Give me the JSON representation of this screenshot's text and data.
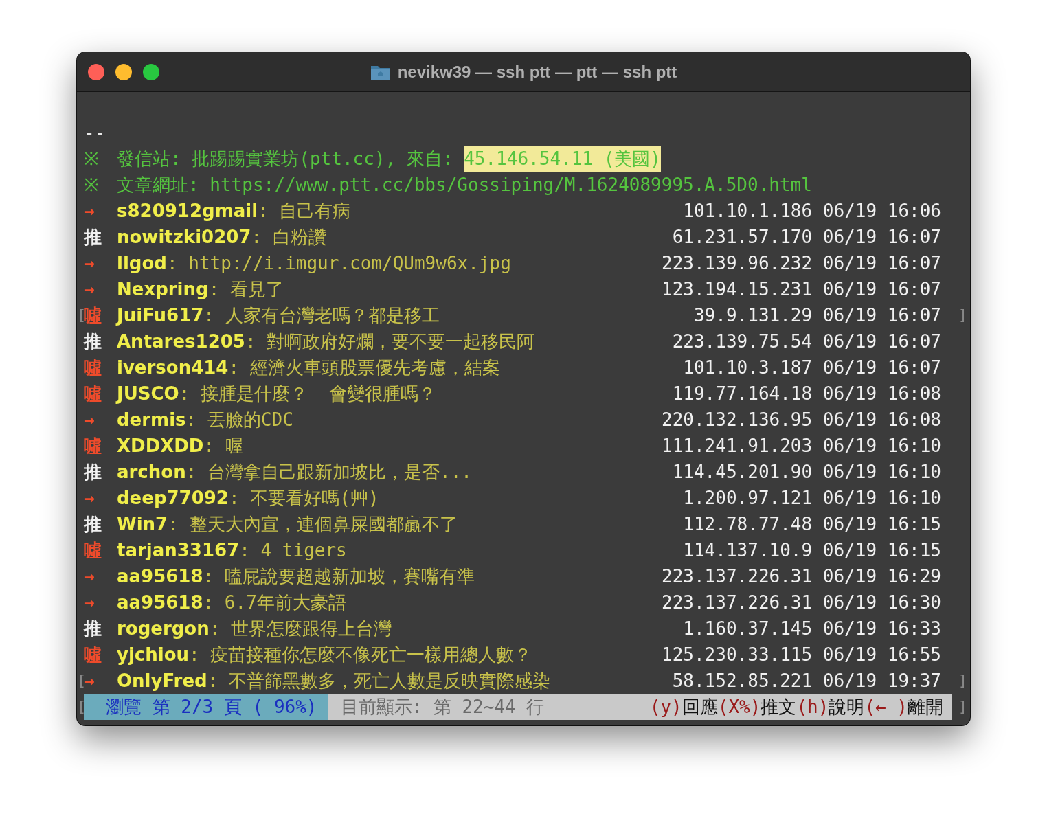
{
  "window": {
    "title": "nevikw39 — ssh ptt — ptt — ssh ptt"
  },
  "terminal": {
    "separator": "--",
    "signature": [
      {
        "mark": "※",
        "label": "發信站: 批踢踢實業坊(ptt.cc), 來自: ",
        "highlight": "45.146.54.11 (美國)"
      },
      {
        "mark": "※",
        "label": "文章網址: https://www.ptt.cc/bbs/Gossiping/M.1624089995.A.5D0.html"
      }
    ],
    "comments": [
      {
        "kind": "arrow",
        "tag": "→",
        "user": "s820912gmail",
        "text": ": 自己有病",
        "ip": "101.10.1.186",
        "datetime": "06/19 16:06"
      },
      {
        "kind": "push",
        "tag": "推",
        "user": "nowitzki0207",
        "text": ": 白粉讚",
        "ip": "61.231.57.170",
        "datetime": "06/19 16:07"
      },
      {
        "kind": "arrow",
        "tag": "→",
        "user": "llgod",
        "text": ": http://i.imgur.com/QUm9w6x.jpg",
        "ip": "223.139.96.232",
        "datetime": "06/19 16:07"
      },
      {
        "kind": "arrow",
        "tag": "→",
        "user": "Nexpring",
        "text": ": 看見了",
        "ip": "123.194.15.231",
        "datetime": "06/19 16:07"
      },
      {
        "kind": "boo",
        "tag": "噓",
        "user": "JuiFu617",
        "text": ": 人家有台灣老嗎？都是移工",
        "ip": "39.9.131.29",
        "datetime": "06/19 16:07",
        "left_mark": "[",
        "right_mark": "]"
      },
      {
        "kind": "push",
        "tag": "推",
        "user": "Antares1205",
        "text": ": 對啊政府好爛，要不要一起移民阿",
        "ip": "223.139.75.54",
        "datetime": "06/19 16:07"
      },
      {
        "kind": "boo",
        "tag": "噓",
        "user": "iverson414",
        "text": ": 經濟火車頭股票優先考慮，結案",
        "ip": "101.10.3.187",
        "datetime": "06/19 16:07"
      },
      {
        "kind": "boo",
        "tag": "噓",
        "user": "JUSCO",
        "text": ": 接腫是什麼？  會變很腫嗎？",
        "ip": "119.77.164.18",
        "datetime": "06/19 16:08"
      },
      {
        "kind": "arrow",
        "tag": "→",
        "user": "dermis",
        "text": ": 丟臉的CDC",
        "ip": "220.132.136.95",
        "datetime": "06/19 16:08"
      },
      {
        "kind": "boo",
        "tag": "噓",
        "user": "XDDXDD",
        "text": ": 喔",
        "ip": "111.241.91.203",
        "datetime": "06/19 16:10"
      },
      {
        "kind": "push",
        "tag": "推",
        "user": "archon",
        "text": ": 台灣拿自己跟新加坡比，是否...",
        "ip": "114.45.201.90",
        "datetime": "06/19 16:10"
      },
      {
        "kind": "arrow",
        "tag": "→",
        "user": "deep77092",
        "text": ": 不要看好嗎(艸)",
        "ip": "1.200.97.121",
        "datetime": "06/19 16:10"
      },
      {
        "kind": "push",
        "tag": "推",
        "user": "Win7",
        "text": ": 整天大內宣，連個鼻屎國都贏不了",
        "ip": "112.78.77.48",
        "datetime": "06/19 16:15"
      },
      {
        "kind": "boo",
        "tag": "噓",
        "user": "tarjan33167",
        "text": ": 4 tigers",
        "ip": "114.137.10.9",
        "datetime": "06/19 16:15"
      },
      {
        "kind": "arrow",
        "tag": "→",
        "user": "aa95618",
        "text": ": 嗑屁說要超越新加坡，賽嘴有準",
        "ip": "223.137.226.31",
        "datetime": "06/19 16:29"
      },
      {
        "kind": "arrow",
        "tag": "→",
        "user": "aa95618",
        "text": ": 6.7年前大豪語",
        "ip": "223.137.226.31",
        "datetime": "06/19 16:30"
      },
      {
        "kind": "push",
        "tag": "推",
        "user": "rogergon",
        "text": ": 世界怎麼跟得上台灣",
        "ip": "1.160.37.145",
        "datetime": "06/19 16:33"
      },
      {
        "kind": "boo",
        "tag": "噓",
        "user": "yjchiou",
        "text": ": 疫苗接種你怎麼不像死亡一樣用總人數？",
        "ip": "125.230.33.115",
        "datetime": "06/19 16:55"
      },
      {
        "kind": "arrow",
        "tag": "→",
        "user": "OnlyFred",
        "text": ": 不普篩黑數多，死亡人數是反映實際感染",
        "ip": "58.152.85.221",
        "datetime": "06/19 19:37",
        "left_mark": "[",
        "right_mark": "]"
      }
    ]
  },
  "status_bar": {
    "left_mark": "[",
    "right_mark": "]",
    "mode": "瀏覽 第 2/3 頁 ( 96%)",
    "position": "目前顯示: 第 22~44 行",
    "hints": [
      {
        "key": "(y)",
        "label": "回應"
      },
      {
        "key": "(X%)",
        "label": "推文"
      },
      {
        "key": "(h)",
        "label": "說明"
      },
      {
        "key": "(← )",
        "label": "離開"
      }
    ]
  }
}
